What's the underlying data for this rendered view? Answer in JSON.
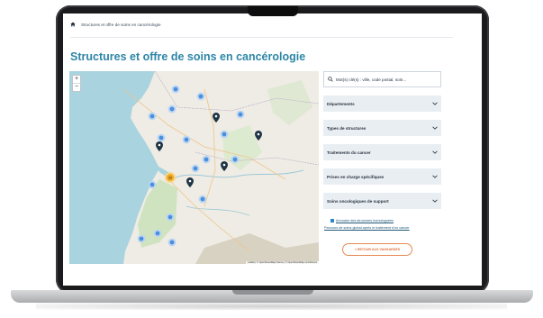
{
  "breadcrumb": {
    "current": "Structures et offre de soins en cancérologie"
  },
  "page": {
    "title": "Structures et offre de soins en cancérologie"
  },
  "map": {
    "zoom_in": "+",
    "zoom_out": "−",
    "attribution": "Leaflet | © OpenStreetMap France | © OpenStreetMap contributors",
    "cluster_highlight_count": "39",
    "cluster_color": "#4a8fdd",
    "highlight_color": "#f0a820",
    "pin_color": "#1f3444"
  },
  "search": {
    "placeholder": "Mot(s) clé(s) : ville, code postal, soin..."
  },
  "filters": [
    {
      "label": "Départements"
    },
    {
      "label": "Types de structures"
    },
    {
      "label": "Traitements du cancer"
    },
    {
      "label": "Prises en charge spécifiques"
    },
    {
      "label": "Soins oncologiques de support"
    }
  ],
  "links": {
    "annuaire": "Annuaire des structures homologuées",
    "parcours": "Parcours de soins global après le traitement d'un cancer"
  },
  "back_button": {
    "label": "< RETOUR AUX VANGARDES"
  },
  "colors": {
    "title": "#2e86a6",
    "accent": "#e2733a",
    "filter_bg": "#e9eef3"
  }
}
